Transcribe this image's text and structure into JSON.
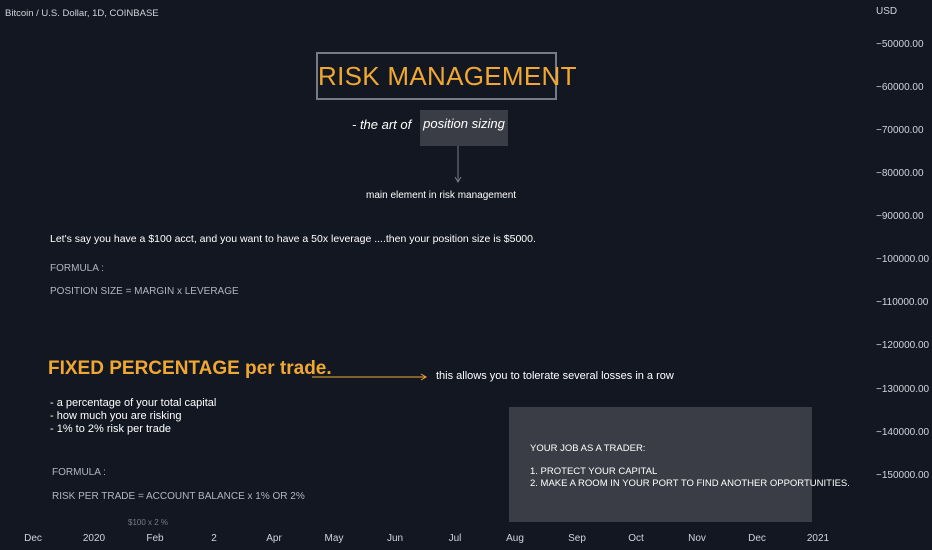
{
  "chart_data": {
    "type": "line",
    "symbol_title": "Bitcoin / U.S. Dollar, 1D, COINBASE",
    "currency": "USD",
    "y_ticks": [
      "−50000.00",
      "−60000.00",
      "−70000.00",
      "−80000.00",
      "−90000.00",
      "−100000.00",
      "−110000.00",
      "−120000.00",
      "−130000.00",
      "−140000.00",
      "−150000.00"
    ],
    "x_ticks": [
      "Dec",
      "2020",
      "Feb",
      "2",
      "Apr",
      "May",
      "Jun",
      "Jul",
      "Aug",
      "Sep",
      "Oct",
      "Nov",
      "Dec",
      "2021"
    ],
    "series": []
  },
  "annotations": {
    "headline": "RISK MANAGEMENT",
    "subtitle_prefix": "- the art of",
    "subtitle_highlight": "position sizing",
    "main_element_note": "main element in risk management",
    "example_line": "Let's say you have a $100 acct, and you want to have a 50x leverage ....then your position size is $5000.",
    "formula_label_1": "FORMULA :",
    "formula_1": "POSITION SIZE  = MARGIN x LEVERAGE",
    "fixed_heading": "FIXED PERCENTAGE per trade.",
    "fixed_note": "this allows you to tolerate several losses in a row",
    "bullets": [
      "- a percentage of your total capital",
      "- how much you are risking",
      "- 1% to 2% risk per trade"
    ],
    "formula_label_2": "FORMULA :",
    "formula_2": "RISK PER TRADE  = ACCOUNT BALANCE x 1% OR 2%",
    "cut_text": "$100 x 2 %",
    "job_title": "YOUR JOB AS A TRADER:",
    "job_items": [
      "1. PROTECT YOUR CAPITAL",
      "2. MAKE A ROOM IN YOUR PORT TO FIND ANOTHER OPPORTUNITIES."
    ]
  },
  "colors": {
    "background": "#131722",
    "accent_orange": "#f0a830",
    "box_gray": "#3a3d45",
    "border_gray": "#787b86",
    "text": "#d1d4dc"
  }
}
